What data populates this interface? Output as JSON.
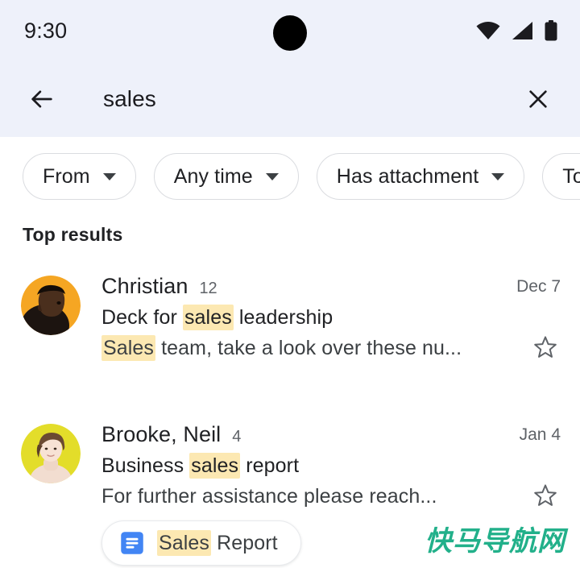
{
  "status_bar": {
    "time": "9:30",
    "icons": [
      "wifi-icon",
      "cellular-signal-icon",
      "battery-icon"
    ],
    "camera_cutout": "camera-punch-hole"
  },
  "search_bar": {
    "back_icon": "back-arrow-icon",
    "query": "sales",
    "clear_icon": "close-x-icon"
  },
  "filters": {
    "chips": [
      {
        "label": "From",
        "caret": "chevron-down-icon"
      },
      {
        "label": "Any time",
        "caret": "chevron-down-icon"
      },
      {
        "label": "Has attachment",
        "caret": "chevron-down-icon"
      },
      {
        "label": "To",
        "caret": "chevron-down-icon"
      }
    ]
  },
  "section": {
    "title": "Top results"
  },
  "results": [
    {
      "sender": "Christian",
      "count": "12",
      "date": "Dec 7",
      "subject_pre": "Deck for ",
      "subject_hl": "sales",
      "subject_post": " leadership",
      "snippet_hl": "Sales",
      "snippet_post": " team, take a look over these nu...",
      "star": "star-outline-icon",
      "avatar": "avatar-christian",
      "attachment": null
    },
    {
      "sender": "Brooke, Neil",
      "count": "4",
      "date": "Jan 4",
      "subject_pre": "Business ",
      "subject_hl": "sales",
      "subject_post": " report",
      "snippet_hl": "",
      "snippet_post": "For further assistance please reach...",
      "star": "star-outline-icon",
      "avatar": "avatar-brooke",
      "attachment": {
        "icon": "google-docs-icon",
        "name_hl": "Sales",
        "name_post": " Report"
      }
    }
  ],
  "watermark": {
    "text": "快马导航网"
  },
  "colors": {
    "header_band": "#eef1fa",
    "highlight": "#fce8b2",
    "chip_border": "#dadce0",
    "text_primary": "#202124",
    "text_secondary": "#5f6368",
    "docs_blue": "#4285f4",
    "watermark_green": "#22b08a"
  }
}
